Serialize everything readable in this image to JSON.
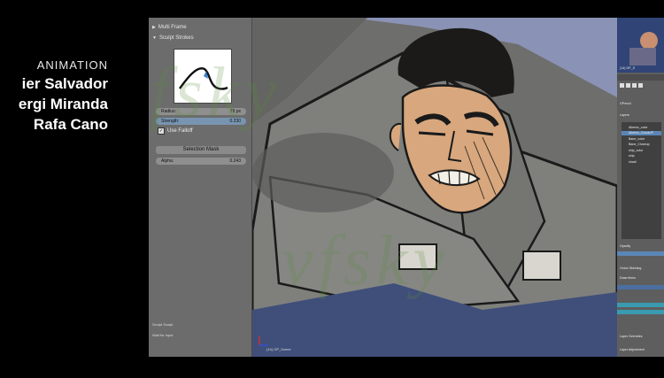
{
  "credits": {
    "heading": "ANIMATION",
    "names": [
      "ier Salvador",
      "ergi Miranda",
      "Rafa Cano"
    ]
  },
  "left_panel": {
    "multi_frame": "Multi Frame",
    "sculpt_strokes": "Sculpt Strokes",
    "radius_label": "Radius:",
    "radius_value": "79 px",
    "strength_label": "Strength:",
    "strength_value": "0.230",
    "use_falloff": "Use Falloff",
    "selection_mask": "Selection Mask",
    "alpha_label": "Alpha:",
    "alpha_value": "0.243",
    "bottom_1": "Sculpt Sculpt",
    "bottom_2": "Wait for input"
  },
  "viewport": {
    "scene_label": "(14) GP_Scene"
  },
  "right_panel": {
    "thumb_label": "(14) GP_S",
    "mode_label": "GPencil",
    "layers_header": "Layers",
    "layers": [
      "Albeniz_color",
      "Albeniz_ClosaUP",
      "Bane_color",
      "Bane_Closeup",
      "ship_color",
      "ship",
      "shadi"
    ],
    "opacity_label": "Opacity",
    "onion_header": "Onion Skinning",
    "draw_items": [
      "Draw items"
    ],
    "layer_overrides": "Layer Overrides",
    "layer_adjustments": "Layer Adjustment"
  },
  "colors": {
    "panel_bg": "#6c6c6c",
    "accent_blue": "#5a86b6",
    "coat_gray": "#7f807c"
  },
  "watermark": "vfsky"
}
